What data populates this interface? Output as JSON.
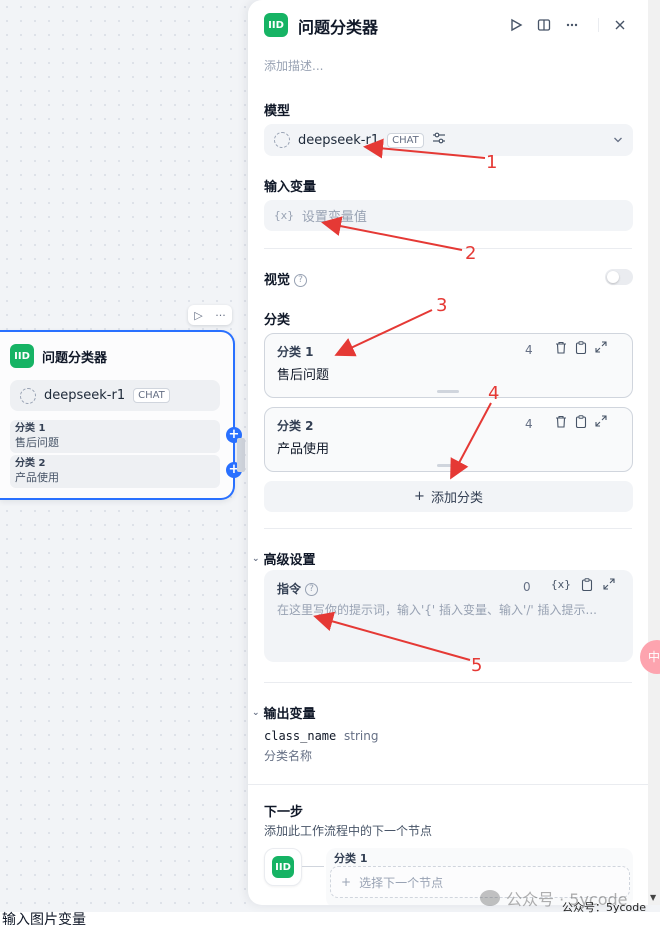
{
  "node": {
    "title": "问题分类器",
    "icon_glyph": "IID",
    "model": "deepseek-r1",
    "badge": "CHAT",
    "toolbar_run": "▷",
    "toolbar_more": "···",
    "classes": [
      {
        "name": "分类 1",
        "text": "售后问题"
      },
      {
        "name": "分类 2",
        "text": "产品使用"
      }
    ]
  },
  "panel": {
    "title": "问题分类器",
    "icon_glyph": "IID",
    "description_placeholder": "添加描述...",
    "header_icons": [
      "play-icon",
      "panel-split-icon",
      "more-icon",
      "close-icon"
    ],
    "model_label": "模型",
    "model_name": "deepseek-r1",
    "model_badge": "CHAT",
    "input_label": "输入变量",
    "input_icon": "{x}",
    "input_placeholder": "设置变量值",
    "vision_label": "视觉",
    "classify_label": "分类",
    "classes": [
      {
        "name": "分类 1",
        "text": "售后问题",
        "count": "4"
      },
      {
        "name": "分类 2",
        "text": "产品使用",
        "count": "4"
      }
    ],
    "add_class_label": "添加分类",
    "advanced_label": "高级设置",
    "instruction_label": "指令",
    "instruction_count": "0",
    "instruction_var_icon": "{x}",
    "instruction_placeholder": "在这里写你的提示词，输入'{' 插入变量、输入'/' 插入提示...",
    "output_label": "输出变量",
    "output_name": "class_name",
    "output_type": "string",
    "output_desc": "分类名称",
    "next_label": "下一步",
    "next_desc": "添加此工作流程中的下一个节点",
    "next_class": "分类 1",
    "next_select": "选择下一个节点"
  },
  "overlay": {
    "watermark": "公众号 · 5ycode",
    "watermark_sub": "公众号：5ycode",
    "bottom_text": "输入图片变量",
    "float_text": "中",
    "annotation_numbers": [
      "1",
      "2",
      "3",
      "4",
      "5"
    ],
    "annotation_color": "#e53935"
  },
  "colors": {
    "accent": "#2970ff",
    "node_icon": "#16b364"
  }
}
